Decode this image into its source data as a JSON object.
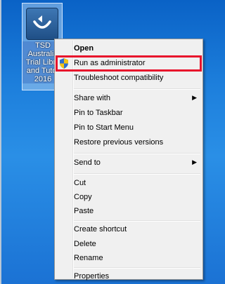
{
  "desktop": {
    "icon_label_lines": [
      "TSD",
      "Australia",
      "Trial Libra",
      "and Tutor",
      "2016"
    ],
    "icon_name": "tsd-app-icon"
  },
  "context_menu": {
    "items": {
      "open": "Open",
      "run_as_admin": "Run as administrator",
      "troubleshoot": "Troubleshoot compatibility",
      "share_with": "Share with",
      "pin_taskbar": "Pin to Taskbar",
      "pin_start": "Pin to Start Menu",
      "restore_prev": "Restore previous versions",
      "send_to": "Send to",
      "cut": "Cut",
      "copy": "Copy",
      "paste": "Paste",
      "create_shortcut": "Create shortcut",
      "delete": "Delete",
      "rename": "Rename",
      "properties": "Properties"
    },
    "submenu_arrow": "▶",
    "highlight_color": "#e8122b"
  }
}
